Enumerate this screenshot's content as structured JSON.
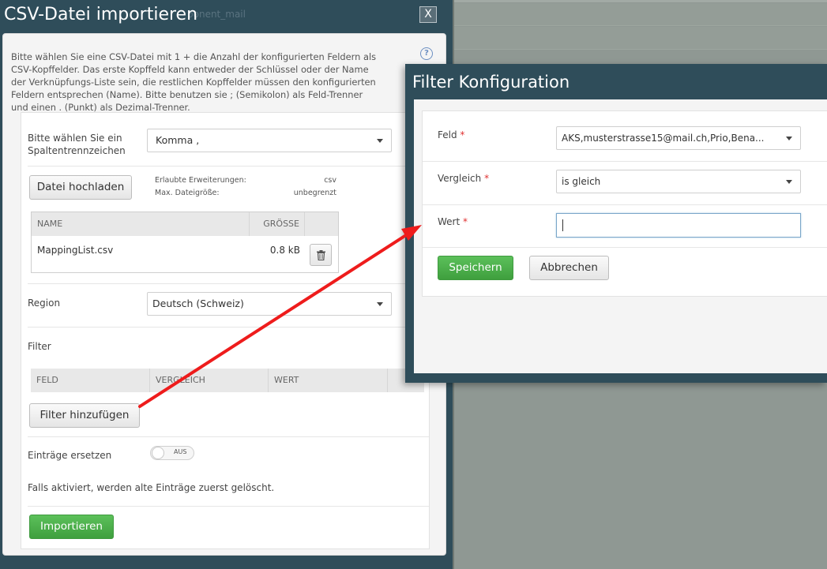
{
  "csv_dialog": {
    "title": "CSV-Datei importieren",
    "title_ghost": "ponent_mail",
    "close_label": "X",
    "help_label": "?",
    "intro_text": "Bitte wählen Sie eine CSV-Datei mit 1 + die Anzahl der konfigurierten Feldern als CSV-Kopffelder. Das erste Kopffeld kann entweder der Schlüssel oder der Name der Verknüpfungs-Liste sein, die restlichen Kopffelder müssen den konfigurierten Feldern entsprechen (Name). Bitte benutzen sie ; (Semikolon) als Feld-Trenner und einen . (Punkt) als Dezimal-Trenner.",
    "separator_label": "Bitte wählen Sie ein Spaltentrennzeichen",
    "separator_value": "Komma ,",
    "upload_button": "Datei hochladen",
    "allowed_ext_label": "Erlaubte Erweiterungen:",
    "allowed_ext_value": "csv",
    "max_size_label": "Max. Dateigröße:",
    "max_size_value": "unbegrenzt",
    "file_table": {
      "headers": [
        "NAME",
        "GRÖSSE"
      ],
      "rows": [
        {
          "name": "MappingList.csv",
          "size": "0.8 kB"
        }
      ]
    },
    "region_label": "Region",
    "region_value": "Deutsch (Schweiz)",
    "filter_label": "Filter",
    "filter_table_headers": [
      "FELD",
      "VERGLEICH",
      "WERT"
    ],
    "add_filter_button": "Filter hinzufügen",
    "replace_label": "Einträge ersetzen",
    "toggle_label": "AUS",
    "replace_hint": "Falls aktiviert, werden alte Einträge zuerst gelöscht.",
    "import_button": "Importieren"
  },
  "filter_dialog": {
    "title": "Filter Konfiguration",
    "field_label": "Feld",
    "field_value": "AKS,musterstrasse15@mail.ch,Prio,Bena...",
    "compare_label": "Vergleich",
    "compare_value": "is gleich",
    "value_label": "Wert",
    "value_input": "",
    "required_marker": "*",
    "save_button": "Speichern",
    "cancel_button": "Abbrechen"
  },
  "colors": {
    "dialog_header": "#2f4d5a",
    "primary_green": "#4cae4c",
    "annotation_arrow": "#ee1c1c"
  }
}
